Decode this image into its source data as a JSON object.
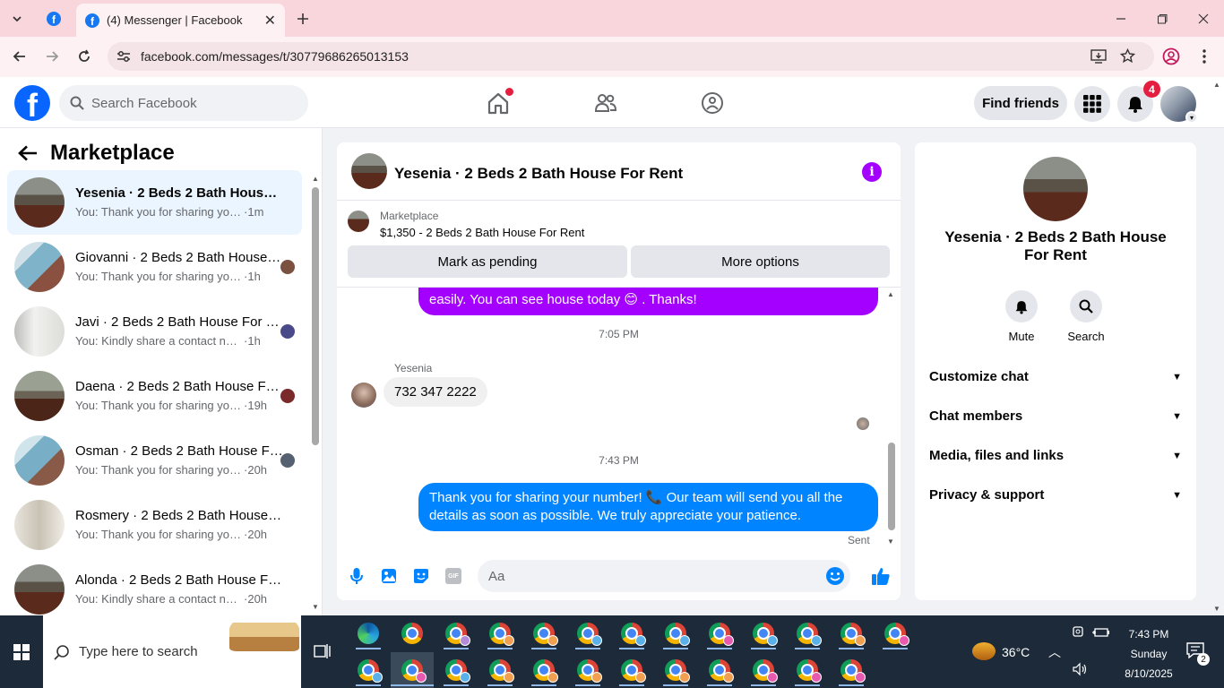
{
  "browser": {
    "tab_title": "(4) Messenger | Facebook",
    "url": "facebook.com/messages/t/30779686265013153",
    "new_tab_icon": "plus-icon"
  },
  "fb_header": {
    "search_placeholder": "Search Facebook",
    "find_friends": "Find friends",
    "notification_count": "4"
  },
  "chat_list": {
    "title": "Marketplace",
    "items": [
      {
        "name": "Yesenia · 2 Beds 2 Bath House For Rent",
        "snippet": "You: Thank you for sharing your number!",
        "time": "1m",
        "active": true
      },
      {
        "name": "Giovanni · 2 Beds 2 Bath House For Rent",
        "snippet": "You: Thank you for sharing your number",
        "time": "1h"
      },
      {
        "name": "Javi · 2 Beds 2 Bath House For Rent",
        "snippet": "You: Kindly share a contact number",
        "time": "1h"
      },
      {
        "name": "Daena · 2 Beds 2 Bath House For Rent",
        "snippet": "You: Thank you for sharing your number",
        "time": "19h"
      },
      {
        "name": "Osman · 2 Beds 2 Bath House For Rent",
        "snippet": "You: Thank you for sharing your number",
        "time": "20h"
      },
      {
        "name": "Rosmery · 2 Beds 2 Bath House For Rent",
        "snippet": "You: Thank you for sharing your number",
        "time": "20h"
      },
      {
        "name": "Alonda · 2 Beds 2 Bath House For Rent",
        "snippet": "You: Kindly share a contact number",
        "time": "20h"
      }
    ]
  },
  "chat": {
    "title": "Yesenia · 2 Beds 2 Bath House For Rent",
    "listing_source": "Marketplace",
    "listing_text": "$1,350 - 2 Beds 2 Bath House For Rent",
    "mark_pending": "Mark as pending",
    "more_options": "More options",
    "messages": {
      "prev_out_tail": "easily. You can see house today 😊 . Thanks!",
      "time1": "7:05 PM",
      "sender_name": "Yesenia",
      "incoming": "732 347 2222",
      "time2": "7:43 PM",
      "outgoing": "Thank you for sharing your number! 📞 Our team will send you all the details as soon as possible. We truly appreciate your patience.",
      "status": "Sent"
    },
    "input_placeholder": "Aa"
  },
  "right_panel": {
    "name": "Yesenia · 2 Beds 2 Bath House For Rent",
    "mute": "Mute",
    "search": "Search",
    "sections": [
      "Customize chat",
      "Chat members",
      "Media, files and links",
      "Privacy & support"
    ]
  },
  "taskbar": {
    "search_placeholder": "Type here to search",
    "temperature": "36°C",
    "time": "7:43 PM",
    "day": "Sunday",
    "date": "8/10/2025",
    "notif_count": "2"
  },
  "colors": {
    "fb_blue": "#0866ff",
    "messenger_blue": "#0084ff",
    "purple_bubble": "#a400ff",
    "tab_bar": "#f9d5dc"
  }
}
